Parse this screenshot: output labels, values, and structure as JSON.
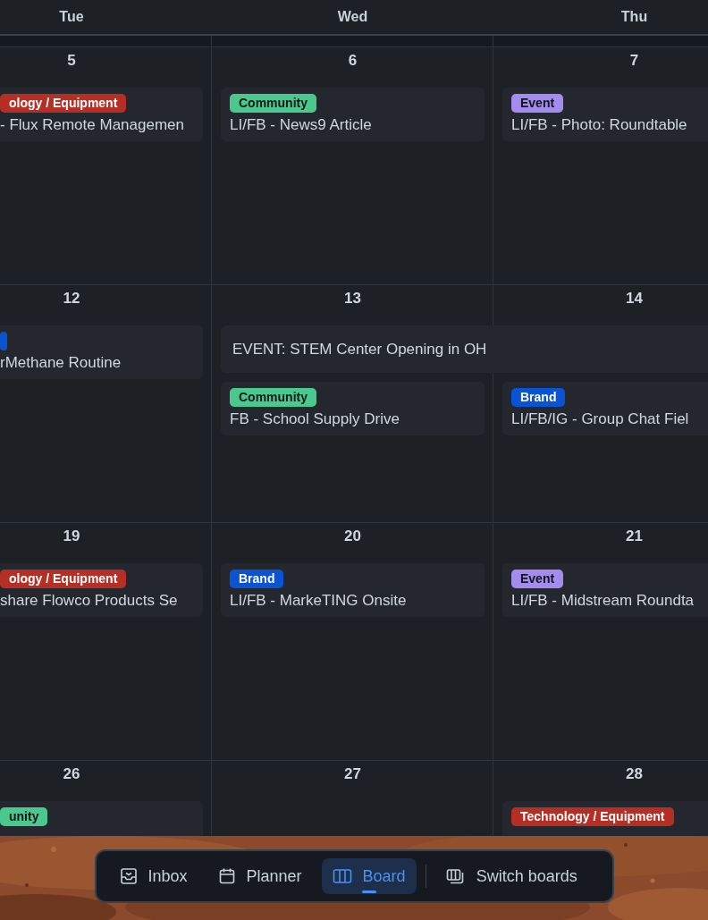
{
  "calendar": {
    "weekdays": [
      "Tue",
      "Wed",
      "Thu"
    ],
    "weeks": [
      {
        "days": [
          {
            "date": "5",
            "events": [
              {
                "kind": "single",
                "tag": {
                  "label": "ology / Equipment",
                  "color": "#b62f25"
                },
                "title": "- Flux Remote Managemen"
              }
            ]
          },
          {
            "date": "6",
            "events": [
              {
                "kind": "single",
                "tag": {
                  "label": "Community",
                  "color": "#4ac98f"
                },
                "title": "LI/FB - News9 Article"
              }
            ]
          },
          {
            "date": "7",
            "events": [
              {
                "kind": "single",
                "tag": {
                  "label": "Event",
                  "color": "#a48bef"
                },
                "title": "LI/FB - Photo: Roundtable"
              }
            ]
          }
        ]
      },
      {
        "days": [
          {
            "date": "12",
            "events": [
              {
                "kind": "single",
                "tag": {
                  "color": "#0a54d4"
                },
                "title": "rMethane Routine"
              }
            ]
          },
          {
            "date": "13",
            "events": [
              {
                "kind": "multi_day",
                "title": "EVENT: STEM Center Opening in OH",
                "continues": true
              },
              {
                "kind": "single",
                "tag": {
                  "label": "Community",
                  "color": "#4ac98f"
                },
                "title": "FB - School Supply Drive"
              }
            ]
          },
          {
            "date": "14",
            "events": [
              {
                "kind": "single",
                "tag": {
                  "label": "Brand",
                  "color": "#0a54d4"
                },
                "title": "LI/FB/IG - Group Chat Fiel"
              }
            ]
          }
        ]
      },
      {
        "days": [
          {
            "date": "19",
            "events": [
              {
                "kind": "single",
                "tag": {
                  "label": "ology / Equipment",
                  "color": "#b62f25"
                },
                "title": "share Flowco Products Se"
              }
            ]
          },
          {
            "date": "20",
            "events": [
              {
                "kind": "single",
                "tag": {
                  "label": "Brand",
                  "color": "#0a54d4"
                },
                "title": "LI/FB - MarkeTING Onsite"
              }
            ]
          },
          {
            "date": "21",
            "events": [
              {
                "kind": "single",
                "tag": {
                  "label": "Event",
                  "color": "#a48bef"
                },
                "title": "LI/FB - Midstream Roundta"
              }
            ]
          }
        ]
      },
      {
        "days": [
          {
            "date": "26",
            "events": [
              {
                "kind": "single",
                "tag": {
                  "label": "unity",
                  "color": "#4ac98f"
                }
              }
            ]
          },
          {
            "date": "27"
          },
          {
            "date": "28",
            "events": [
              {
                "kind": "single",
                "tag": {
                  "label": "Technology / Equipment",
                  "color": "#b62f25"
                }
              }
            ]
          }
        ]
      }
    ]
  },
  "toolbar": {
    "views": [
      {
        "kind": "inbox",
        "label": "Inbox",
        "selected": false
      },
      {
        "kind": "planner",
        "label": "Planner",
        "selected": false
      },
      {
        "kind": "board",
        "label": "Board",
        "selected": true
      }
    ],
    "action": {
      "kind": "switch",
      "label": "Switch boards"
    }
  }
}
